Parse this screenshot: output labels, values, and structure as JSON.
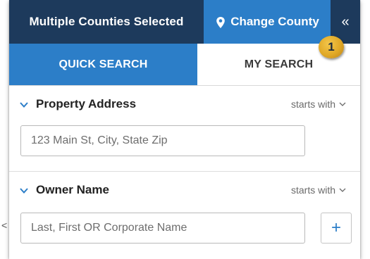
{
  "header": {
    "selected_label": "Multiple Counties Selected",
    "change_county_label": "Change County",
    "collapse_glyph": "«",
    "badge_number": "1",
    "colors": {
      "dark": "#1d3a5c",
      "accent": "#2c7ec8",
      "badge": "#e0a826"
    }
  },
  "tabs": [
    {
      "label": "QUICK SEARCH",
      "active": true
    },
    {
      "label": "MY SEARCH",
      "active": false
    }
  ],
  "sections": [
    {
      "title": "Property Address",
      "match_mode": "starts with",
      "input_placeholder": "123 Main St, City, State Zip"
    },
    {
      "title": "Owner Name",
      "match_mode": "starts with",
      "input_placeholder": "Last, First OR Corporate Name",
      "add_button": "+"
    }
  ],
  "edge_glyph": "<",
  "icons": [
    "map-marker-icon",
    "chevron-down-icon",
    "caret-down-icon",
    "double-chevron-left-icon",
    "plus-icon"
  ]
}
